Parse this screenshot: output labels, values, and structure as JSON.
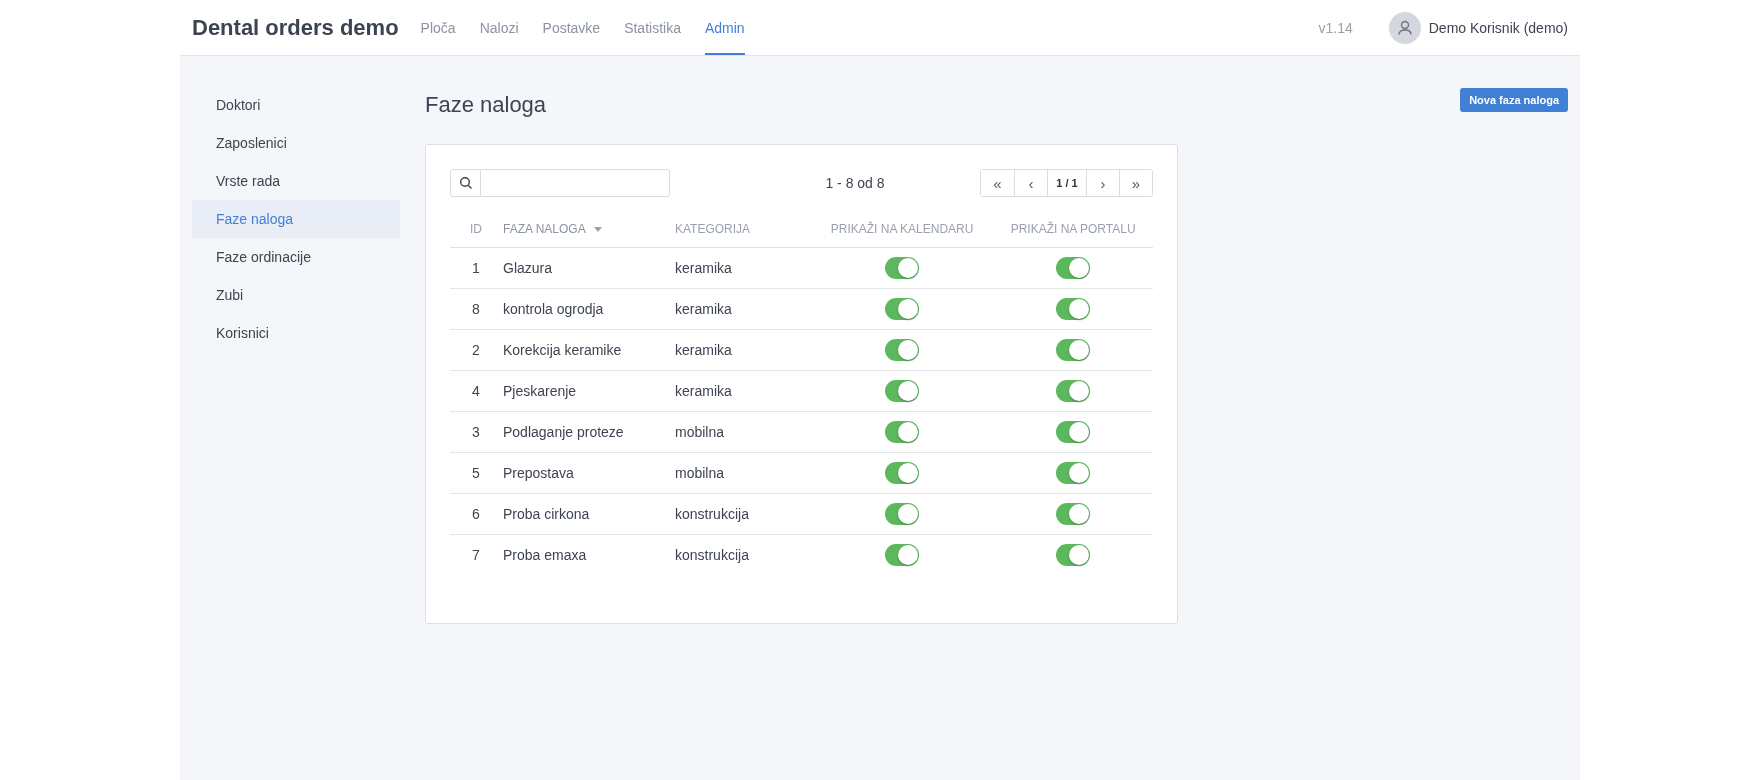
{
  "app_title": "Dental orders demo",
  "nav": [
    {
      "label": "Ploča",
      "selected": false
    },
    {
      "label": "Nalozi",
      "selected": false
    },
    {
      "label": "Postavke",
      "selected": false
    },
    {
      "label": "Statistika",
      "selected": false
    },
    {
      "label": "Admin",
      "selected": true
    }
  ],
  "version": "v1.14",
  "user": "Demo Korisnik (demo)",
  "sidebar": {
    "items": [
      {
        "label": "Doktori",
        "selected": false
      },
      {
        "label": "Zaposlenici",
        "selected": false
      },
      {
        "label": "Vrste rada",
        "selected": false
      },
      {
        "label": "Faze naloga",
        "selected": true
      },
      {
        "label": "Faze ordinacije",
        "selected": false
      },
      {
        "label": "Zubi",
        "selected": false
      },
      {
        "label": "Korisnici",
        "selected": false
      }
    ]
  },
  "page_title": "Faze naloga",
  "new_button": "Nova faza naloga",
  "range": "1 - 8 od 8",
  "pagination": {
    "first": "«",
    "prev": "‹",
    "page": "1 / 1",
    "next": "›",
    "last": "»"
  },
  "table": {
    "columns": [
      {
        "label": "ID",
        "sorted": false
      },
      {
        "label": "FAZA NALOGA",
        "sorted": true
      },
      {
        "label": "KATEGORIJA",
        "sorted": false
      },
      {
        "label": "PRIKAŽI NA KALENDARU",
        "sorted": false
      },
      {
        "label": "PRIKAŽI NA PORTALU",
        "sorted": false
      }
    ],
    "rows": [
      {
        "id": "1",
        "name": "Glazura",
        "category": "keramika",
        "calendar": true,
        "portal": true
      },
      {
        "id": "8",
        "name": "kontrola ogrodja",
        "category": "keramika",
        "calendar": true,
        "portal": true
      },
      {
        "id": "2",
        "name": "Korekcija keramike",
        "category": "keramika",
        "calendar": true,
        "portal": true
      },
      {
        "id": "4",
        "name": "Pjeskarenje",
        "category": "keramika",
        "calendar": true,
        "portal": true
      },
      {
        "id": "3",
        "name": "Podlaganje proteze",
        "category": "mobilna",
        "calendar": true,
        "portal": true
      },
      {
        "id": "5",
        "name": "Prepostava",
        "category": "mobilna",
        "calendar": true,
        "portal": true
      },
      {
        "id": "6",
        "name": "Proba cirkona",
        "category": "konstrukcija",
        "calendar": true,
        "portal": true
      },
      {
        "id": "7",
        "name": "Proba emaxa",
        "category": "konstrukcija",
        "calendar": true,
        "portal": true
      }
    ]
  }
}
